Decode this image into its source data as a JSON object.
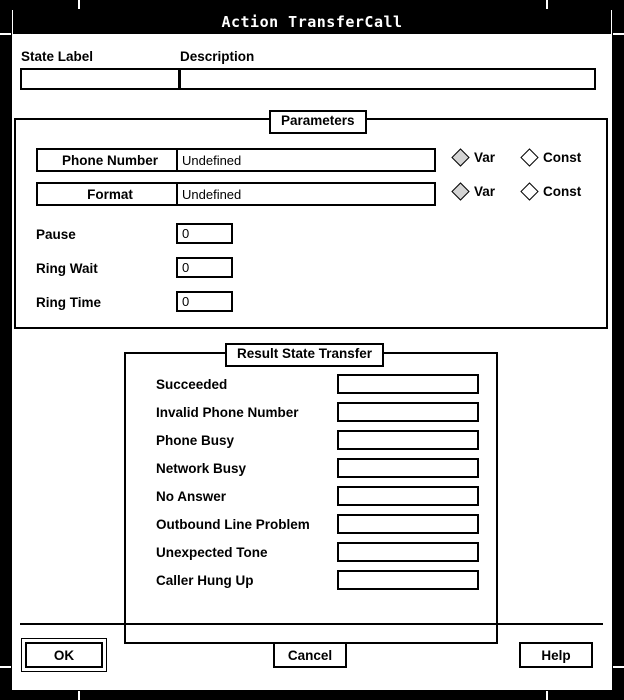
{
  "window": {
    "title": "Action TransferCall"
  },
  "top": {
    "state_label": "State Label",
    "state_value": "",
    "description_label": "Description",
    "description_value": ""
  },
  "parameters": {
    "legend": "Parameters",
    "rows": [
      {
        "button": "Phone Number",
        "value": "Undefined",
        "var_label": "Var",
        "const_label": "Const",
        "selected": "Var"
      },
      {
        "button": "Format",
        "value": "Undefined",
        "var_label": "Var",
        "const_label": "Const",
        "selected": "Var"
      }
    ],
    "numeric": [
      {
        "label": "Pause",
        "value": "0"
      },
      {
        "label": "Ring Wait",
        "value": "0"
      },
      {
        "label": "Ring Time",
        "value": "0"
      }
    ]
  },
  "result_state_transfer": {
    "legend": "Result State Transfer",
    "rows": [
      {
        "label": "Succeeded",
        "value": ""
      },
      {
        "label": "Invalid Phone Number",
        "value": ""
      },
      {
        "label": "Phone Busy",
        "value": ""
      },
      {
        "label": "Network Busy",
        "value": ""
      },
      {
        "label": "No Answer",
        "value": ""
      },
      {
        "label": "Outbound Line Problem",
        "value": ""
      },
      {
        "label": "Unexpected Tone",
        "value": ""
      },
      {
        "label": "Caller Hung Up",
        "value": ""
      }
    ]
  },
  "actions": {
    "ok": "OK",
    "cancel": "Cancel",
    "help": "Help"
  },
  "colors": {
    "frame": "#000000",
    "background": "#ffffff",
    "text": "#000000",
    "radio_selected_fill": "#d4d4d4"
  }
}
